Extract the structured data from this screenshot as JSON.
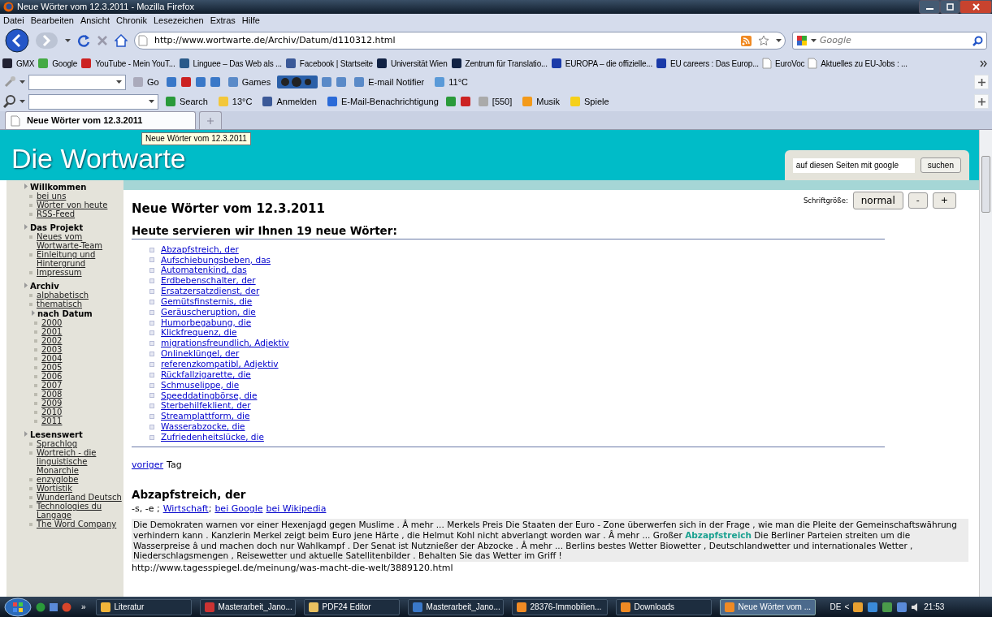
{
  "window": {
    "title": "Neue Wörter vom 12.3.2011 - Mozilla Firefox"
  },
  "menu": [
    "Datei",
    "Bearbeiten",
    "Ansicht",
    "Chronik",
    "Lesezeichen",
    "Extras",
    "Hilfe"
  ],
  "navigation": {
    "url": "http://www.wortwarte.de/Archiv/Datum/d110312.html",
    "search_placeholder": "Google"
  },
  "bookmarks": [
    "GMX",
    "Google",
    "YouTube - Mein YouT...",
    "Linguee – Das Web als ...",
    "Facebook | Startseite",
    "Universität Wien",
    "Zentrum für Translatio...",
    "EUROPA – die offizielle...",
    "EU careers : Das Europ...",
    "EuroVoc",
    "Aktuelles zu EU-Jobs : ..."
  ],
  "toolbar_1": [
    "Go",
    "Games",
    "E-mail Notifier",
    "11°C"
  ],
  "toolbar_2": [
    "Search",
    "13°C",
    "Anmelden",
    "E-Mail-Benachrichtigung",
    "[550]",
    "Musik",
    "Spiele"
  ],
  "tabs": [
    {
      "label": "Neue Wörter vom 12.3.2011",
      "selected": true
    }
  ],
  "tooltip": "Neue Wörter vom 12.3.2011",
  "site": {
    "title": "Die Wortwarte",
    "search_value": "auf diesen Seiten mit google",
    "search_button": "suchen"
  },
  "sidebar": [
    {
      "label": "Willkommen",
      "children": [
        {
          "label": "bei uns"
        },
        {
          "label": "Wörter von heute"
        },
        {
          "label": "RSS-Feed"
        }
      ]
    },
    {
      "label": "Das Projekt",
      "children": [
        {
          "label": "Neues vom Wortwarte-Team"
        },
        {
          "label": "Einleitung und Hintergrund"
        },
        {
          "label": "Impressum"
        }
      ]
    },
    {
      "label": "Archiv",
      "children": [
        {
          "label": "alphabetisch"
        },
        {
          "label": "thematisch"
        },
        {
          "label": "nach Datum",
          "children": [
            {
              "label": "2000"
            },
            {
              "label": "2001"
            },
            {
              "label": "2002"
            },
            {
              "label": "2003"
            },
            {
              "label": "2004"
            },
            {
              "label": "2005"
            },
            {
              "label": "2006"
            },
            {
              "label": "2007"
            },
            {
              "label": "2008"
            },
            {
              "label": "2009"
            },
            {
              "label": "2010"
            },
            {
              "label": "2011"
            }
          ]
        }
      ]
    },
    {
      "label": "Lesenswert",
      "children": [
        {
          "label": "Sprachlog"
        },
        {
          "label": "Wortreich - die linguistische Monarchie"
        },
        {
          "label": "enzyglobe"
        },
        {
          "label": "Wortistik"
        },
        {
          "label": "Wunderland Deutsch"
        },
        {
          "label": "Technologies du Langage"
        },
        {
          "label": "The Word Company"
        }
      ]
    }
  ],
  "headline": "Neue Wörter vom 12.3.2011",
  "font_size": {
    "label": "Schriftgröße:",
    "buttons": [
      "normal",
      "-",
      "+"
    ]
  },
  "subheading": "Heute servieren wir Ihnen 19 neue Wörter:",
  "words": [
    "Abzapfstreich, der",
    "Aufschiebungsbeben, das",
    "Automatenkind, das",
    "Erdbebenschalter, der",
    "Ersatzersatzdienst, der",
    "Gemütsfinsternis, die",
    "Geräuscheruption, die",
    "Humorbegabung, die",
    "Klickfrequenz, die",
    "migrationsfreundlich, Adjektiv",
    "Onlineklüngel, der",
    "referenzkompatibl, Adjektiv",
    "Rückfallzigarette, die",
    "Schmuselippe, die",
    "Speeddatingbörse, die",
    "Sterbehilfeklient, der",
    "Streamplattform, die",
    "Wasserabzocke, die",
    "Zufriedenheitslücke, die"
  ],
  "previous": {
    "link": "voriger",
    "text": "Tag"
  },
  "entry": {
    "heading": "Abzapfstreich, der",
    "grammar": "-s, -e ;",
    "topic_link": "Wirtschaft",
    "separator": ";",
    "links": [
      "bei Google",
      "bei Wikipedia"
    ],
    "citation": "Die Demokraten warnen vor einer Hexenjagd gegen Muslime . Â mehr ... Merkels Preis Die Staaten der Euro - Zone überwerfen sich in der Frage , wie man die Pleite der Gemeinschaftswährung verhindern kann . Kanzlerin Merkel zeigt beim Euro jene Härte , die Helmut Kohl nicht abverlangt worden war . Â mehr ... Großer **Abzapfstreich** Die Berliner Parteien streiten um die Wasserpreise â und machen doch nur Wahlkampf . Der Senat ist Nutznießer der Abzocke . Â mehr ... Berlins bestes Wetter Biowetter , Deutschlandwetter und internationales Wetter , Niederschlagsmengen , Reisewetter und aktuelle Satellitenbilder . Behalten Sie das Wetter im Griff !",
    "source": "http://www.tagesspiegel.de/meinung/was-macht-die-welt/3889120.html"
  },
  "taskbar": {
    "items": [
      {
        "label": "Literatur",
        "selected": false
      },
      {
        "label": "Masterarbeit_Jano...",
        "selected": false
      },
      {
        "label": "PDF24 Editor",
        "selected": false
      },
      {
        "label": "Masterarbeit_Jano...",
        "selected": false
      },
      {
        "label": "28376-Immobilien...",
        "selected": false
      },
      {
        "label": "Downloads",
        "selected": false
      },
      {
        "label": "Neue Wörter vom ...",
        "selected": true
      }
    ],
    "overflow": "»",
    "language": "DE",
    "tray_arrow": "<",
    "time": "21:53"
  }
}
